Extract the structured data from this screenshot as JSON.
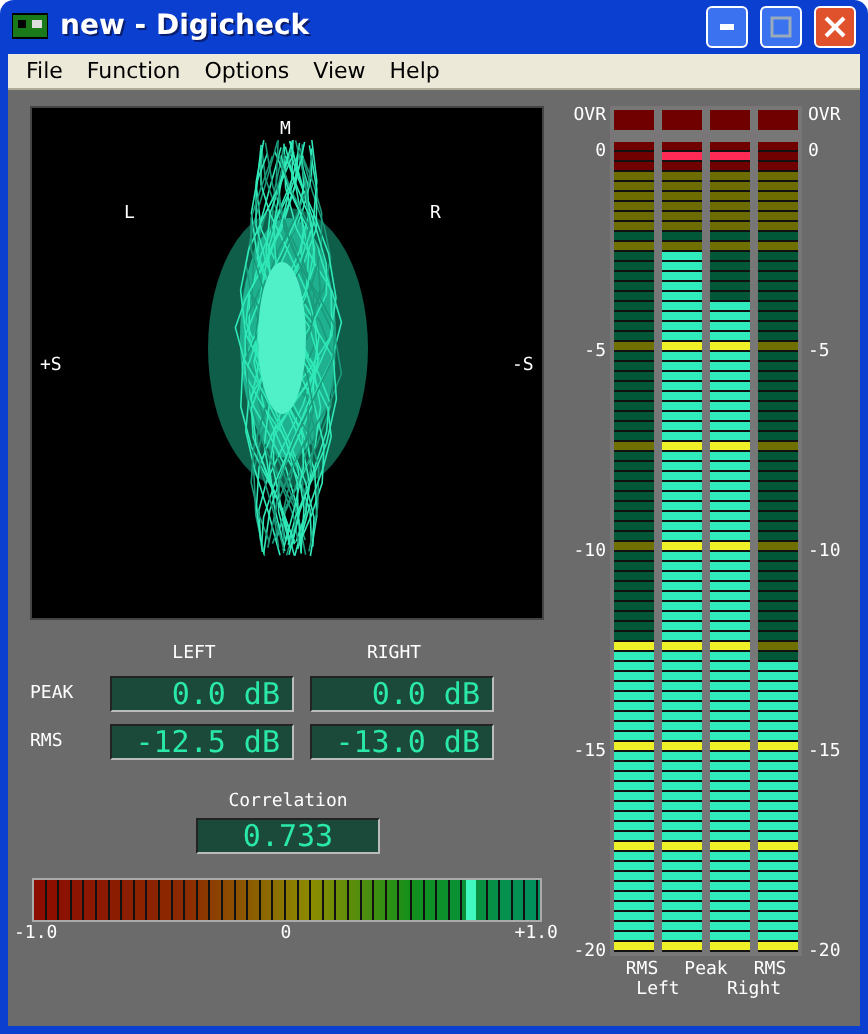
{
  "window": {
    "title": "new - Digicheck"
  },
  "menu": [
    "File",
    "Function",
    "Options",
    "View",
    "Help"
  ],
  "goniometer": {
    "labels": [
      {
        "kind": "top",
        "text": "M"
      },
      {
        "kind": "upper_left",
        "text": "L"
      },
      {
        "kind": "upper_right",
        "text": "R"
      },
      {
        "kind": "left",
        "text": "+S"
      },
      {
        "kind": "right",
        "text": "-S"
      }
    ]
  },
  "readouts": {
    "columns": [
      "LEFT",
      "RIGHT"
    ],
    "rows": [
      {
        "label": "PEAK",
        "values": [
          "0.0 dB",
          "0.0 dB"
        ]
      },
      {
        "label": "RMS",
        "values": [
          "-12.5 dB",
          "-13.0 dB"
        ]
      }
    ]
  },
  "correlation": {
    "title": "Correlation",
    "value": "0.733",
    "level": 0.866,
    "ticks": [
      "-1.0",
      "0",
      "+1.0"
    ]
  },
  "left_scale": [
    "OVR",
    "0",
    "-5",
    "-10",
    "-15",
    "-20"
  ],
  "right_scale": [
    "OVR",
    "0",
    "-5",
    "-10",
    "-15",
    "-20"
  ],
  "meters": [
    {
      "level": 0.38,
      "peak_hold": false
    },
    {
      "level": 0.87,
      "peak_hold": true
    },
    {
      "level": 0.8,
      "peak_hold": true
    },
    {
      "level": 0.355,
      "peak_hold": false
    }
  ],
  "meter_labels": {
    "top": [
      "RMS",
      "Peak",
      "RMS"
    ],
    "bottom": [
      "Left",
      "Right"
    ]
  }
}
